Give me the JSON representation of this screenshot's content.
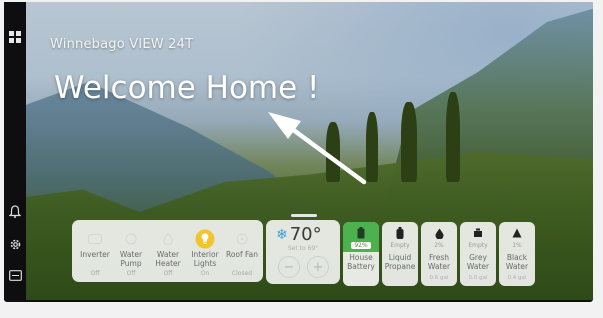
{
  "header": {
    "subtitle": "Winnebago VIEW 24T",
    "title": "Welcome Home !"
  },
  "sidebar": {
    "items": [
      {
        "icon": "grid-icon"
      },
      {
        "icon": "bell-icon"
      },
      {
        "icon": "gear-icon"
      },
      {
        "icon": "display-icon"
      }
    ]
  },
  "devices": [
    {
      "label": "Inverter",
      "status": "Off",
      "icon": "power-icon",
      "active": false
    },
    {
      "label": "Water Pump",
      "status": "Off",
      "icon": "pump-icon",
      "active": false
    },
    {
      "label": "Water Heater",
      "status": "Off",
      "icon": "flame-icon",
      "active": false
    },
    {
      "label": "Interior Lights",
      "status": "On",
      "icon": "bulb-icon",
      "active": true
    },
    {
      "label": "Roof Fan",
      "status": "Closed",
      "icon": "fan-icon",
      "active": false
    }
  ],
  "thermostat": {
    "temperature": "70°",
    "set_text": "Set to 69°",
    "minus": "−",
    "plus": "+"
  },
  "tanks": [
    {
      "label": "House Battery",
      "level": "92%",
      "value": "",
      "icon": "battery-icon",
      "active": true
    },
    {
      "label": "Liquid Propane",
      "level": "Empty",
      "value": "",
      "icon": "propane-icon",
      "active": false
    },
    {
      "label": "Fresh Water",
      "level": "2%",
      "value": "0.6 gal",
      "icon": "water-drop-icon",
      "active": false
    },
    {
      "label": "Grey Water",
      "level": "Empty",
      "value": "0.0 gal",
      "icon": "grey-tank-icon",
      "active": false
    },
    {
      "label": "Black Water",
      "level": "1%",
      "value": "0.4 gal",
      "icon": "black-tank-icon",
      "active": false
    }
  ],
  "colors": {
    "accent_green": "#4bb24f",
    "bulb_yellow": "#f4c430",
    "snow_blue": "#3aa3d8"
  }
}
